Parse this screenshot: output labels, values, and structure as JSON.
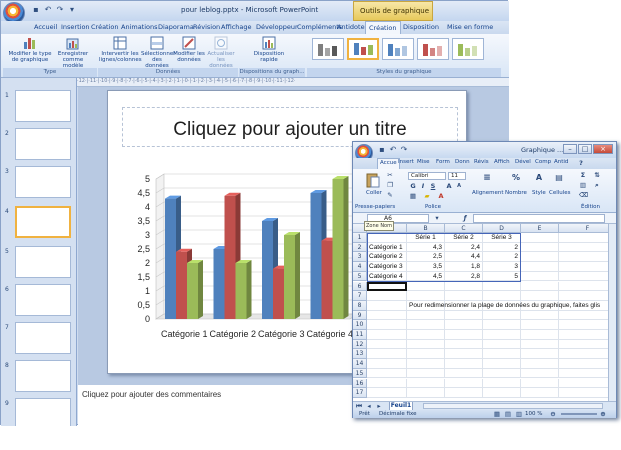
{
  "powerpoint": {
    "caption": "pour leblog.pptx - Microsoft PowerPoint",
    "tools_tab": "Outils de graphique",
    "tabs": [
      "Accueil",
      "Insertion",
      "Création",
      "Animations",
      "Diaporama",
      "Révision",
      "Affichage",
      "Développeur",
      "Compléments",
      "Antidote",
      "Création",
      "Disposition",
      "Mise en forme"
    ],
    "ribbon": {
      "type_group": {
        "label": "Type",
        "buttons": [
          "Modifier le type de graphique",
          "Enregistrer comme modèle"
        ]
      },
      "data_group": {
        "label": "Données",
        "buttons": [
          "Intervertir les lignes/colonnes",
          "Sélectionner des données",
          "Modifier les données",
          "Actualiser les données"
        ]
      },
      "layout_group": {
        "label": "Dispositions du graph...",
        "buttons": [
          "Disposition rapide"
        ]
      },
      "styles_group": {
        "label": "Styles du graphique"
      }
    },
    "ruler_text": "·12·|·11·|·10·|·9·|·8·|·7·|·6·|·5·|·4·|·3·|·2·|·1·|·0·|·1·|·2·|·3·|·4·|·5·|·6·|·7·|·8·|·9·|·10·|·11·|·12·",
    "slide_numbers": [
      "1",
      "2",
      "3",
      "4",
      "5",
      "6",
      "7",
      "8",
      "9"
    ],
    "title_placeholder": "Cliquez pour ajouter un titre",
    "notes_placeholder": "Cliquez pour ajouter des commentaires"
  },
  "chart_data": {
    "type": "bar",
    "categories": [
      "Catégorie 1",
      "Catégorie 2",
      "Catégorie 3",
      "Catégorie 4"
    ],
    "series": [
      {
        "name": "Série 1",
        "values": [
          4.3,
          2.5,
          3.5,
          4.5
        ],
        "color": "#4f81bd"
      },
      {
        "name": "Série 2",
        "values": [
          2.4,
          4.4,
          1.8,
          2.8
        ],
        "color": "#c0504d"
      },
      {
        "name": "Série 3",
        "values": [
          2,
          2,
          3,
          5
        ],
        "color": "#9bbb59"
      }
    ],
    "ylim": [
      0,
      5
    ],
    "yticks": [
      "0",
      "0,5",
      "1",
      "1,5",
      "2",
      "2,5",
      "3",
      "3,5",
      "4",
      "4,5",
      "5"
    ],
    "grid": true,
    "style": "3d-clustered-column"
  },
  "excel": {
    "caption": "Graphique ...",
    "tabs": [
      "Accue",
      "Insert",
      "Mise",
      "Form",
      "Donn",
      "Révis",
      "Affich",
      "Dével",
      "Comp",
      "Antid"
    ],
    "ribbon": {
      "paste_label": "Coller",
      "font_name": "Calibri",
      "font_size": "11",
      "alignment_label": "Alignement",
      "number_label": "Nombre",
      "style_label": "Style",
      "cells_label": "Cellules",
      "clipboard_label": "Presse-papiers",
      "font_label": "Police",
      "editing_label": "Édition"
    },
    "name_box": "A6",
    "name_box_tooltip": "Zone Nom",
    "columns": [
      "A",
      "B",
      "C",
      "D",
      "E",
      "F"
    ],
    "rows": [
      "1",
      "2",
      "3",
      "4",
      "5",
      "6",
      "7",
      "8",
      "9",
      "10",
      "11",
      "12",
      "13",
      "14",
      "15",
      "16",
      "17"
    ],
    "cells": {
      "A2": "Catégorie 1",
      "A3": "Catégorie 2",
      "A4": "Catégorie 3",
      "A5": "Catégorie 4",
      "B1": "Série 1",
      "C1": "Série 2",
      "D1": "Série 3",
      "B2": "4,3",
      "B3": "2,5",
      "B4": "3,5",
      "B5": "4,5",
      "C2": "2,4",
      "C3": "4,4",
      "C4": "1,8",
      "C5": "2,8",
      "D2": "2",
      "D3": "2",
      "D4": "3",
      "D5": "5"
    },
    "note": "Pour redimensionner la plage de données du graphique, faites glis",
    "sheet_tab": "Feuil1",
    "status_ready": "Prêt",
    "status_fixed": "Décimale fixe",
    "zoom": "100 %"
  }
}
